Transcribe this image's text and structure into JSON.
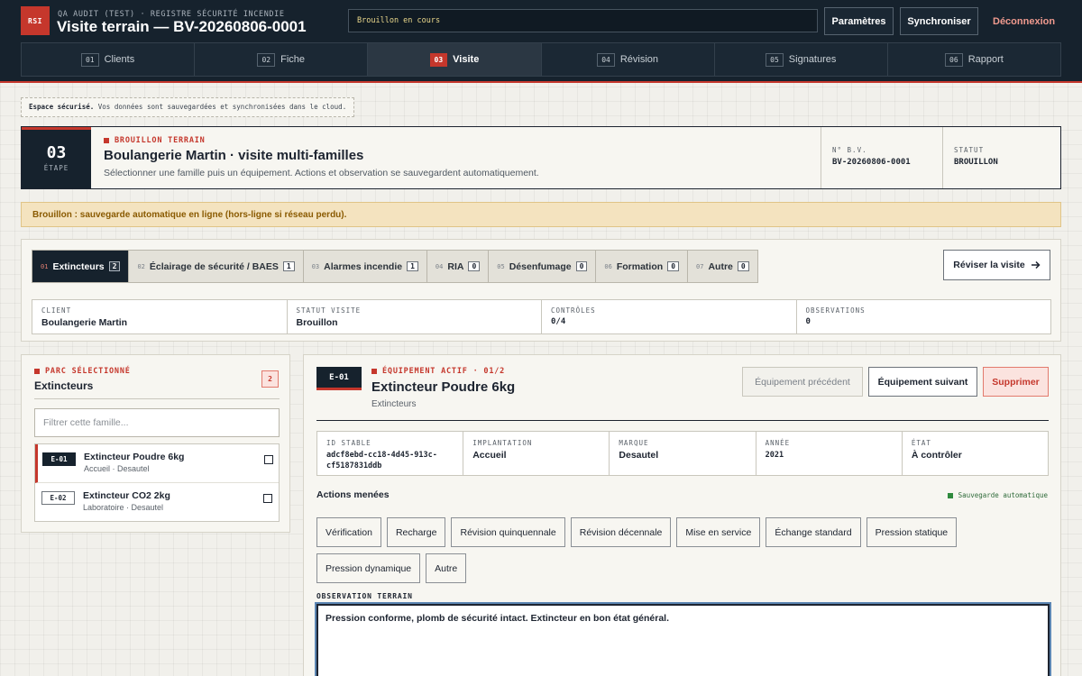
{
  "header": {
    "logo": "RSI",
    "subtitle": "QA AUDIT (TEST) · REGISTRE SÉCURITÉ INCENDIE",
    "title": "Visite terrain — BV-20260806-0001",
    "status": "Brouillon en cours",
    "buttons": {
      "settings": "Paramètres",
      "sync": "Synchroniser",
      "logout": "Déconnexion"
    },
    "steps": [
      {
        "num": "01",
        "label": "Clients"
      },
      {
        "num": "02",
        "label": "Fiche"
      },
      {
        "num": "03",
        "label": "Visite"
      },
      {
        "num": "04",
        "label": "Révision"
      },
      {
        "num": "05",
        "label": "Signatures"
      },
      {
        "num": "06",
        "label": "Rapport"
      }
    ]
  },
  "secure_notice": {
    "bold": "Espace sécurisé.",
    "text": "Vos données sont sauvegardées et synchronisées dans le cloud."
  },
  "hero": {
    "step_num": "03",
    "step_label": "ÉTAPE",
    "kicker": "BROUILLON TERRAIN",
    "title": "Boulangerie Martin · visite multi-familles",
    "description": "Sélectionner une famille puis un équipement. Actions et observation se sauvegardent automatiquement.",
    "bv_label": "N° B.V.",
    "bv_value": "BV-20260806-0001",
    "status_label": "STATUT",
    "status_value": "BROUILLON"
  },
  "draft_banner": "Brouillon : sauvegarde automatique en ligne (hors-ligne si réseau perdu).",
  "families": {
    "tabs": [
      {
        "num": "01",
        "label": "Extincteurs",
        "count": "2"
      },
      {
        "num": "02",
        "label": "Éclairage de sécurité / BAES",
        "count": "1"
      },
      {
        "num": "03",
        "label": "Alarmes incendie",
        "count": "1"
      },
      {
        "num": "04",
        "label": "RIA",
        "count": "0"
      },
      {
        "num": "05",
        "label": "Désenfumage",
        "count": "0"
      },
      {
        "num": "06",
        "label": "Formation",
        "count": "0"
      },
      {
        "num": "07",
        "label": "Autre",
        "count": "0"
      }
    ],
    "review_button": "Réviser la visite",
    "info": [
      {
        "label": "CLIENT",
        "value": "Boulangerie Martin"
      },
      {
        "label": "STATUT VISITE",
        "value": "Brouillon"
      },
      {
        "label": "CONTRÔLES",
        "value": "0/4"
      },
      {
        "label": "OBSERVATIONS",
        "value": "0"
      }
    ]
  },
  "fleet": {
    "kicker": "PARC SÉLECTIONNÉ",
    "title": "Extincteurs",
    "count": "2",
    "filter_placeholder": "Filtrer cette famille...",
    "items": [
      {
        "tag": "E-01",
        "name": "Extincteur Poudre 6kg",
        "sub": "Accueil · Desautel"
      },
      {
        "tag": "E-02",
        "name": "Extincteur CO2 2kg",
        "sub": "Laboratoire · Desautel"
      }
    ]
  },
  "equipment": {
    "tag": "E-01",
    "kicker": "ÉQUIPEMENT ACTIF · 01/2",
    "title": "Extincteur Poudre 6kg",
    "family": "Extincteurs",
    "buttons": {
      "prev": "Équipement précédent",
      "next": "Équipement suivant",
      "delete": "Supprimer"
    },
    "details": [
      {
        "label": "ID STABLE",
        "value": "adcf8ebd-cc18-4d45-913c-cf5187831ddb"
      },
      {
        "label": "IMPLANTATION",
        "value": "Accueil"
      },
      {
        "label": "MARQUE",
        "value": "Desautel"
      },
      {
        "label": "ANNÉE",
        "value": "2021"
      },
      {
        "label": "ÉTAT",
        "value": "À contrôler"
      }
    ],
    "actions_title": "Actions menées",
    "autosave": "Sauvegarde automatique",
    "actions": [
      "Vérification",
      "Recharge",
      "Révision quinquennale",
      "Révision décennale",
      "Mise en service",
      "Échange standard",
      "Pression statique",
      "Pression dynamique",
      "Autre"
    ],
    "observation_label": "OBSERVATION TERRAIN",
    "observation": "Pression conforme, plomb de sécurité intact. Extincteur en bon état général."
  }
}
